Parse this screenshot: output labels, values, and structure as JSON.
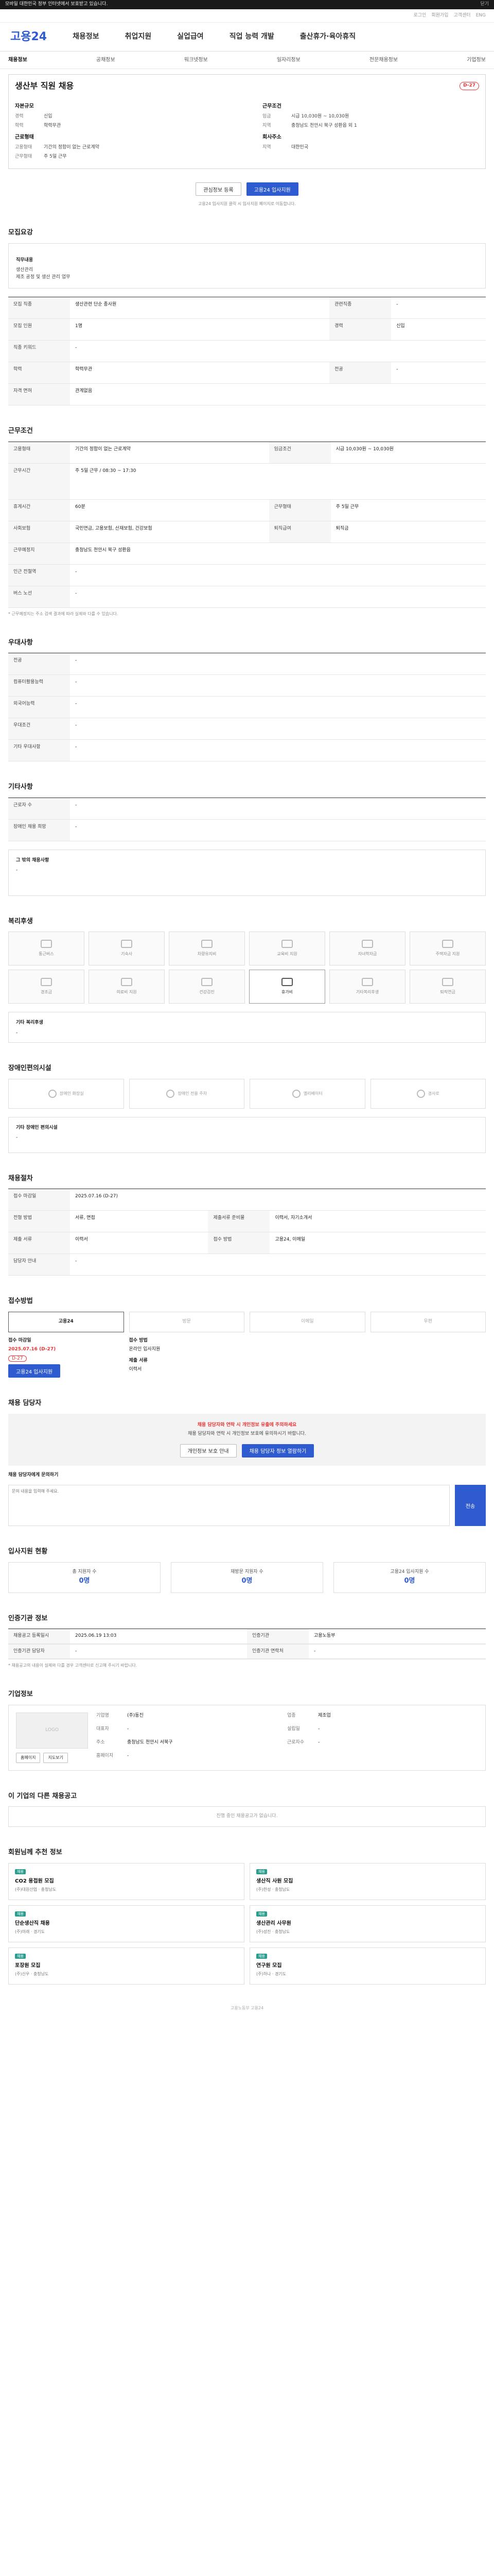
{
  "topbar": {
    "text": "모바일 대한민국 정부 인터넷에서 보호받고 있습니다.",
    "right": "닫기"
  },
  "subtop": [
    "로그인",
    "회원가입",
    "고객센터",
    "ENG"
  ],
  "gnb": {
    "logo": "고용24",
    "items": [
      "채용정보",
      "취업지원",
      "실업급여",
      "직업 능력 개발",
      "출산휴가·육아휴직"
    ]
  },
  "lnb": [
    "채용정보",
    "공채정보",
    "워크넷정보",
    "일자리정보",
    "전문채용정보",
    "기업정보"
  ],
  "head": {
    "title": "생산부 직원 채용",
    "dday": "D-27",
    "left_h1": "자본규모",
    "left": [
      {
        "k": "경력",
        "v": "신입"
      },
      {
        "k": "학력",
        "v": "학력무관"
      }
    ],
    "left_h2": "근로형태",
    "left2": [
      {
        "k": "고용형태",
        "v": "기간의 정함이 없는 근로계약"
      },
      {
        "k": "근무형태",
        "v": "주 5일 근무"
      }
    ],
    "right_h1": "근무조건",
    "right": [
      {
        "k": "임금",
        "v": "시급 10,030원 ~ 10,030원"
      },
      {
        "k": "지역",
        "v": "충청남도 천안시 북구 성환읍 외 1"
      }
    ],
    "right_h2": "회사주소",
    "right2": [
      {
        "k": "지역",
        "v": "대한민국"
      }
    ]
  },
  "buttons": {
    "like": "관심정보 등록",
    "apply": "고용24 입사지원"
  },
  "head_note": "고용24 입사지원 클릭 시 입사지원 페이지로 이동합니다.",
  "sec1": {
    "title": "모집요강",
    "desc_h": "직무내용",
    "desc": [
      "생산관리",
      "제조 공정 및 생산 관리 업무"
    ],
    "rows": [
      {
        "k": "모집 직종",
        "v": "생산관련 단순 종사원",
        "k2": "관련직종",
        "v2": "-"
      },
      {
        "k": "모집 인원",
        "v": "1명",
        "k2": "경력",
        "v2": "신입"
      },
      {
        "k": "직종 키워드",
        "v": "-",
        "k2": "",
        "v2": ""
      },
      {
        "k": "학력",
        "v": "학력무관",
        "k2": "전공",
        "v2": "-"
      },
      {
        "k": "자격 면허",
        "v": "관계없음",
        "k2": "",
        "v2": ""
      }
    ]
  },
  "sec2": {
    "title": "근무조건",
    "rows": [
      {
        "k": "고용형태",
        "v": "기간의 정함이 없는 근로계약",
        "k2": "임금조건",
        "v2": "시급 10,030원 ~ 10,030원"
      },
      {
        "k": "근무시간",
        "v": "주 5일 근무 / 08:30 ~ 17:30",
        "k2": "",
        "v2": ""
      },
      {
        "k": "휴게시간",
        "v": "60분",
        "k2": "근무형태",
        "v2": "주 5일 근무"
      },
      {
        "k": "사회보험",
        "v": "국민연금, 고용보험, 산재보험, 건강보험",
        "k2": "퇴직급여",
        "v2": "퇴직금"
      },
      {
        "k": "근무예정지",
        "v": "충청남도 천안시 북구 성환읍",
        "k2": "",
        "v2": ""
      },
      {
        "k": "인근 전철역",
        "v": "-",
        "k2": "",
        "v2": ""
      },
      {
        "k": "버스 노선",
        "v": "-",
        "k2": "",
        "v2": ""
      }
    ],
    "note": "* 근무예정지는 주소 검색 결과에 따라 실제와 다를 수 있습니다."
  },
  "sec3": {
    "title": "우대사항",
    "rows": [
      {
        "k": "전공",
        "v": "-"
      },
      {
        "k": "컴퓨터활용능력",
        "v": "-"
      },
      {
        "k": "외국어능력",
        "v": "-"
      },
      {
        "k": "우대조건",
        "v": "-"
      },
      {
        "k": "기타 우대사항",
        "v": "-"
      }
    ]
  },
  "sec4": {
    "title": "기타사항",
    "rows": [
      {
        "k": "근로자 수",
        "v": "-"
      },
      {
        "k": "장애인 채용 희망",
        "v": "-"
      }
    ],
    "extra_h": "그 밖의 채용사항",
    "extra": "-"
  },
  "sec5": {
    "title": "복리후생",
    "items": [
      "통근버스",
      "기숙사",
      "차량유지비",
      "교육비 지원",
      "자녀학자금",
      "주택자금 지원",
      "경조금",
      "의료비 지원",
      "건강검진",
      "휴가비",
      "기타복리후생",
      "퇴직연금"
    ],
    "on_index": 9,
    "other_h": "기타 복리후생",
    "other": "-"
  },
  "sec6": {
    "title": "장애인편의시설",
    "items": [
      "장애인 화장실",
      "장애인 전용 주차",
      "엘리베이터",
      "경사로"
    ],
    "other_h": "기타 장애인 편의시설",
    "other": "-"
  },
  "sec7": {
    "title": "채용절차",
    "rows": [
      {
        "k": "접수 마감일",
        "v": "2025.07.16 (D-27)",
        "k2": "",
        "v2": ""
      },
      {
        "k": "전형 방법",
        "v": "서류, 면접",
        "k2": "제출서류 준비물",
        "v2": "이력서, 자기소개서"
      },
      {
        "k": "제출 서류",
        "v": "이력서",
        "k2": "접수 방법",
        "v2": "고용24, 이메일"
      },
      {
        "k": "담당자 안내",
        "v": "-",
        "k2": "",
        "v2": ""
      }
    ]
  },
  "sec8": {
    "title": "접수방법",
    "tabs": [
      "고용24",
      "방문",
      "이메일",
      "우편"
    ],
    "on_index": 0,
    "deadline_label": "접수 마감일",
    "deadline": "2025.07.16 (D-27)",
    "dday": "D-27",
    "apply_button": "고용24 입사지원",
    "method_label": "접수 방법",
    "method": "온라인 입사지원",
    "form_label": "제출 서류",
    "form": "이력서"
  },
  "sec9": {
    "title": "채용 담당자",
    "warn_title": "채용 담당자와 연락 시 개인정보 유출에 주의하세요",
    "warn_text": "채용 담당자와 연락 시 개인정보 보호에 유의하시기 바랍니다.",
    "btn1": "개인정보 보호 안내",
    "btn2": "채용 담당자 정보 열람하기",
    "inquiry_label": "채용 담당자에게 문의하기",
    "inquiry_placeholder": "문의 내용을 입력해 주세요.",
    "send": "전송"
  },
  "sec10": {
    "title": "입사지원 현황",
    "stats": [
      {
        "label": "총 지원자 수",
        "value": "0명"
      },
      {
        "label": "재방문 지원자 수",
        "value": "0명"
      },
      {
        "label": "고용24 입사지원 수",
        "value": "0명"
      }
    ]
  },
  "sec11": {
    "title": "인증기관 정보",
    "rows": [
      {
        "k": "채용공고 등록일시",
        "v": "2025.06.19 13:03",
        "k2": "인증기관",
        "v2": "고용노동부"
      },
      {
        "k": "인증기관 담당자",
        "v": "-",
        "k2": "인증기관 연락처",
        "v2": "-"
      }
    ],
    "note": "* 채용공고의 내용이 실제와 다를 경우 고객센터로 신고해 주시기 바랍니다."
  },
  "sec12": {
    "title": "기업정보",
    "logo": "LOGO",
    "rows": [
      {
        "k": "기업명",
        "v": "(주)동진",
        "k2": "업종",
        "v2": "제조업"
      },
      {
        "k": "대표자",
        "v": "-",
        "k2": "설립일",
        "v2": "-"
      },
      {
        "k": "주소",
        "v": "충청남도 천안시 서북구",
        "k2": "근로자수",
        "v2": "-"
      },
      {
        "k": "홈페이지",
        "v": "-",
        "k2": "",
        "v2": ""
      }
    ],
    "homepage_btn": "홈페이지",
    "map_btn": "지도보기"
  },
  "sec13": {
    "title": "이 기업의 다른 채용공고",
    "empty": "진행 중인 채용공고가 없습니다."
  },
  "sec14": {
    "title": "회원님께 추천 정보",
    "items": [
      {
        "tag": "채용",
        "title": "CO2 용접원 모집",
        "meta": "(주)대원산업 · 충청남도"
      },
      {
        "tag": "채용",
        "title": "생산직 사원 모집",
        "meta": "(주)한성 · 충청남도"
      },
      {
        "tag": "채용",
        "title": "단순생산직 채용",
        "meta": "(주)미래 · 경기도"
      },
      {
        "tag": "채용",
        "title": "생산관리 사무원",
        "meta": "(주)성진 · 충청남도"
      },
      {
        "tag": "채용",
        "title": "포장원 모집",
        "meta": "(주)신우 · 충청남도"
      },
      {
        "tag": "채용",
        "title": "연구원 모집",
        "meta": "(주)하나 · 경기도"
      }
    ]
  },
  "footer": "고용노동부 고용24"
}
